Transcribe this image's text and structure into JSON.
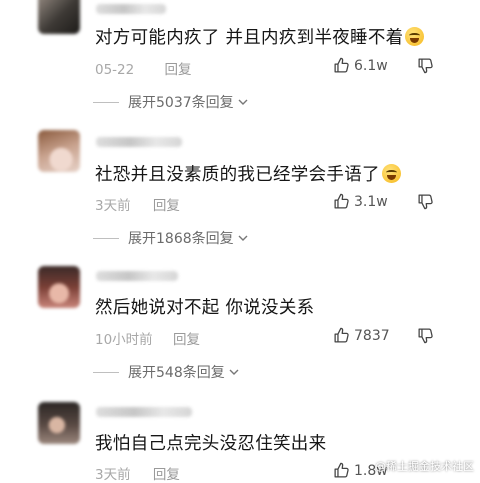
{
  "comments": [
    {
      "text": "对方可能内疚了 并且内疚到半夜睡不着",
      "emoji": "tears-of-joy-emoji",
      "time": "05-22",
      "reply_label": "回复",
      "likes": "6.1w",
      "expand_label": "展开5037条回复"
    },
    {
      "text": "社恐并且没素质的我已经学会手语了",
      "emoji": "tears-of-joy-emoji",
      "time": "3天前",
      "reply_label": "回复",
      "likes": "3.1w",
      "expand_label": "展开1868条回复"
    },
    {
      "text": "然后她说对不起 你说没关系",
      "time": "10小时前",
      "reply_label": "回复",
      "likes": "7837",
      "expand_label": "展开548条回复"
    },
    {
      "text": "我怕自己点完头没忍住笑出来",
      "time": "3天前",
      "reply_label": "回复",
      "likes": "1.8w"
    }
  ],
  "watermark": "@稀土掘金技术社区",
  "colors": {
    "text": "#161616",
    "meta": "#a8a8a8",
    "background": "#ffffff"
  }
}
